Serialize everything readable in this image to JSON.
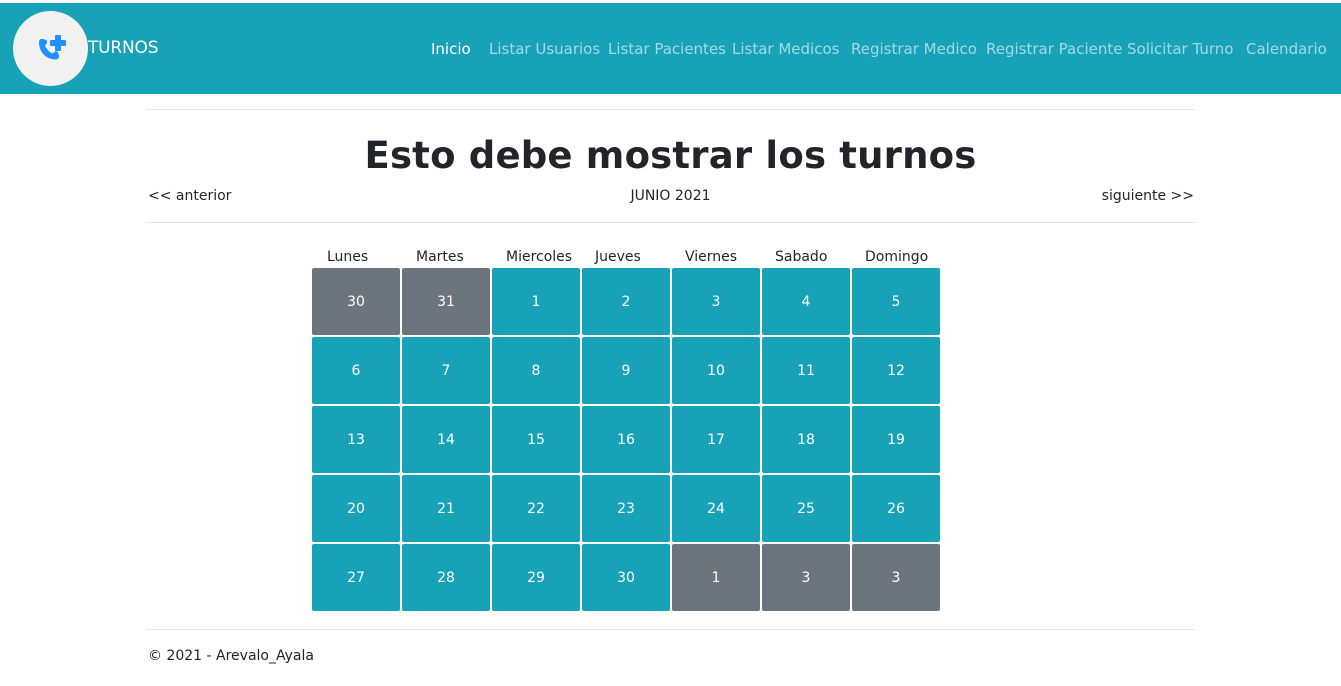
{
  "header": {
    "brand": "TURNOS",
    "nav": [
      {
        "label": "Inicio",
        "active": true
      },
      {
        "label": "Listar Usuarios",
        "active": false
      },
      {
        "label": "Listar Pacientes",
        "active": false
      },
      {
        "label": "Listar Medicos",
        "active": false
      },
      {
        "label": "Registrar Medico",
        "active": false
      },
      {
        "label": "Registrar Paciente",
        "active": false
      },
      {
        "label": "Solicitar Turno",
        "active": false
      },
      {
        "label": "Calendario",
        "active": false
      }
    ]
  },
  "main": {
    "title": "Esto debe mostrar los turnos",
    "prev_label": "<< anterior",
    "next_label": "siguiente >>",
    "month_label": "JUNIO 2021"
  },
  "calendar": {
    "weekdays": [
      "Lunes",
      "Martes",
      "Miercoles",
      "Jueves",
      "Viernes",
      "Sabado",
      "Domingo"
    ],
    "days": [
      {
        "label": "30",
        "current_month": false
      },
      {
        "label": "31",
        "current_month": false
      },
      {
        "label": "1",
        "current_month": true
      },
      {
        "label": "2",
        "current_month": true
      },
      {
        "label": "3",
        "current_month": true
      },
      {
        "label": "4",
        "current_month": true
      },
      {
        "label": "5",
        "current_month": true
      },
      {
        "label": "6",
        "current_month": true
      },
      {
        "label": "7",
        "current_month": true
      },
      {
        "label": "8",
        "current_month": true
      },
      {
        "label": "9",
        "current_month": true
      },
      {
        "label": "10",
        "current_month": true
      },
      {
        "label": "11",
        "current_month": true
      },
      {
        "label": "12",
        "current_month": true
      },
      {
        "label": "13",
        "current_month": true
      },
      {
        "label": "14",
        "current_month": true
      },
      {
        "label": "15",
        "current_month": true
      },
      {
        "label": "16",
        "current_month": true
      },
      {
        "label": "17",
        "current_month": true
      },
      {
        "label": "18",
        "current_month": true
      },
      {
        "label": "19",
        "current_month": true
      },
      {
        "label": "20",
        "current_month": true
      },
      {
        "label": "21",
        "current_month": true
      },
      {
        "label": "22",
        "current_month": true
      },
      {
        "label": "23",
        "current_month": true
      },
      {
        "label": "24",
        "current_month": true
      },
      {
        "label": "25",
        "current_month": true
      },
      {
        "label": "26",
        "current_month": true
      },
      {
        "label": "27",
        "current_month": true
      },
      {
        "label": "28",
        "current_month": true
      },
      {
        "label": "29",
        "current_month": true
      },
      {
        "label": "30",
        "current_month": true
      },
      {
        "label": "1",
        "current_month": false
      },
      {
        "label": "3",
        "current_month": false
      },
      {
        "label": "3",
        "current_month": false
      }
    ]
  },
  "footer": {
    "text": "© 2021 - Arevalo_Ayala"
  },
  "colors": {
    "navbar": "#17a2b8",
    "day_current": "#17a2b8",
    "day_other": "#6c757d",
    "logo_icon": "#1e90ff"
  },
  "icons": {
    "logo": "phone-medical-icon"
  }
}
